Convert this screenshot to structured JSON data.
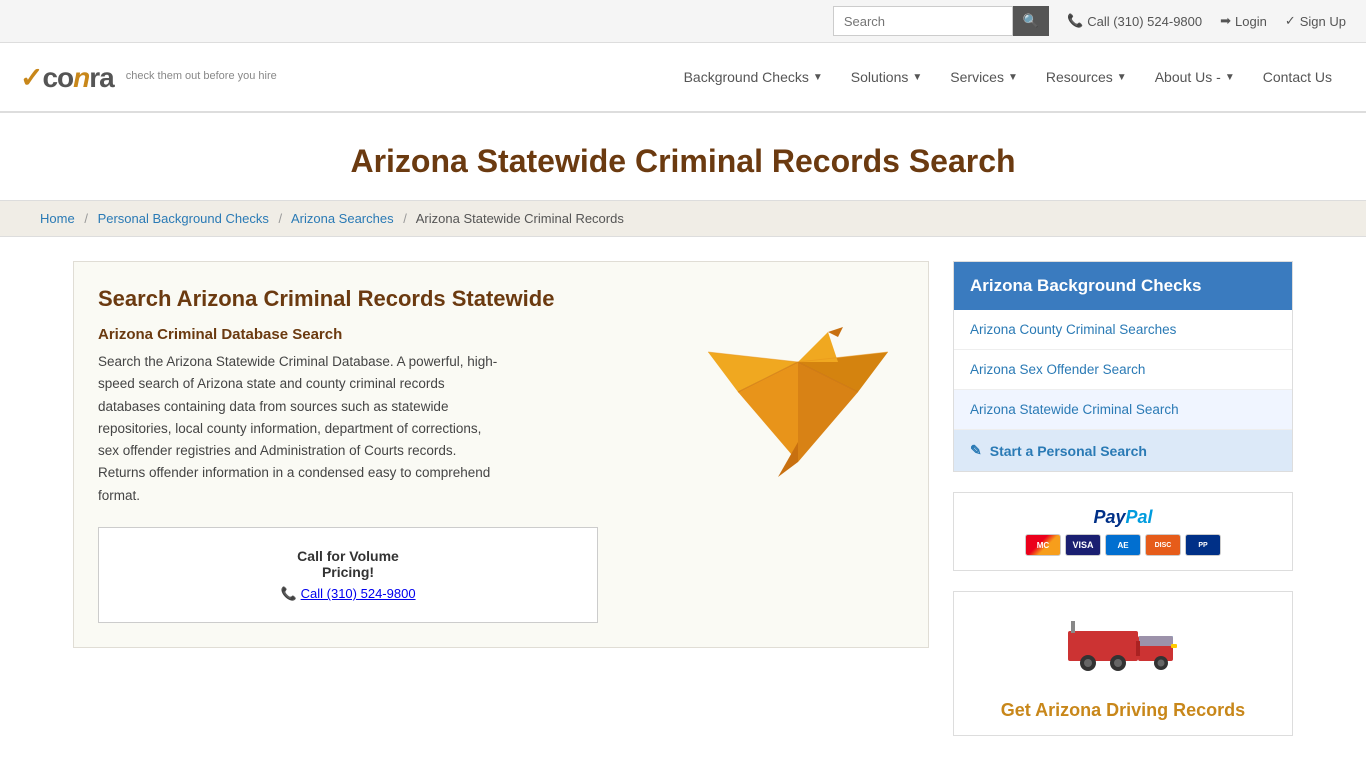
{
  "topbar": {
    "search_placeholder": "Search",
    "search_btn_icon": "🔍",
    "phone": "Call (310) 524-9800",
    "login": "Login",
    "signup": "Sign Up"
  },
  "nav": {
    "logo_tagline": "check them out before you hire",
    "links": [
      {
        "label": "Background Checks",
        "has_caret": true
      },
      {
        "label": "Solutions",
        "has_caret": true
      },
      {
        "label": "Services",
        "has_caret": true
      },
      {
        "label": "Resources",
        "has_caret": true
      },
      {
        "label": "About Us -",
        "has_caret": true
      },
      {
        "label": "Contact Us",
        "has_caret": false
      }
    ]
  },
  "page": {
    "title": "Arizona Statewide Criminal Records Search"
  },
  "breadcrumb": {
    "items": [
      "Home",
      "Personal Background Checks",
      "Arizona Searches"
    ],
    "current": "Arizona Statewide Criminal Records"
  },
  "main": {
    "heading": "Search Arizona Criminal Records Statewide",
    "subheading": "Arizona Criminal Database Search",
    "body": "Search the Arizona Statewide Criminal Database. A powerful, high-speed search of Arizona state and county criminal records databases containing data from sources such as statewide repositories, local county information, department of corrections, sex offender registries and Administration of Courts records. Returns offender information in a condensed easy to comprehend format.",
    "volume_box": {
      "title1": "Call for Volume",
      "title2": "Pricing!",
      "phone_text": "Call (310) 524-9800"
    }
  },
  "sidebar": {
    "checks_header": "Arizona Background Checks",
    "checks_items": [
      {
        "label": "Arizona County Criminal Searches",
        "active": false
      },
      {
        "label": "Arizona Sex Offender Search",
        "active": false
      },
      {
        "label": "Arizona Statewide Criminal Search",
        "active": true
      }
    ],
    "cta_label": "Start a Personal Search",
    "driving_title": "Get Arizona Driving Records"
  }
}
